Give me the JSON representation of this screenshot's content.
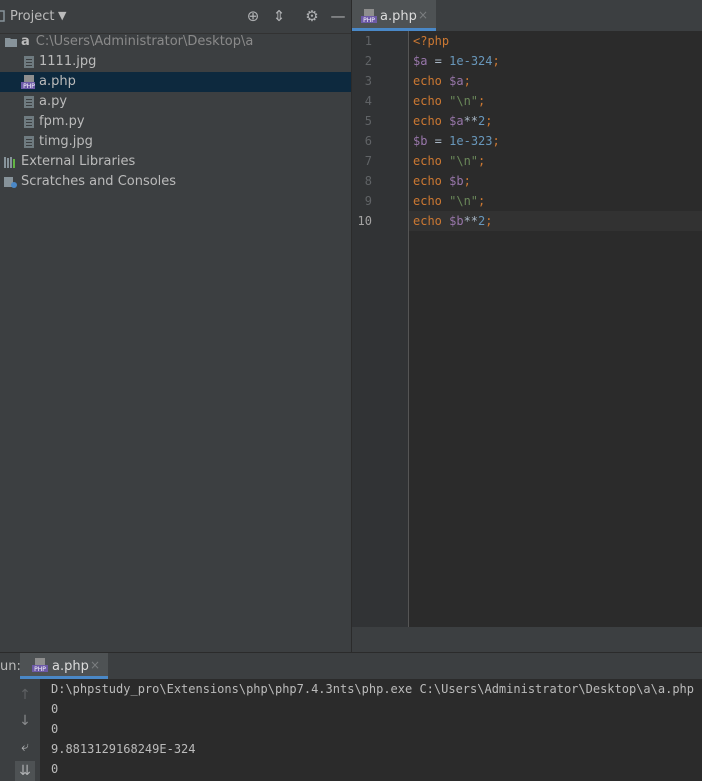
{
  "project": {
    "title": "Project",
    "tree": [
      {
        "label": "a",
        "path": "C:\\Users\\Administrator\\Desktop\\a",
        "icon": "folder-icon"
      },
      {
        "label": "1111.jpg",
        "icon": "image-file-icon"
      },
      {
        "label": "a.php",
        "icon": "php-file-icon",
        "selected": true
      },
      {
        "label": "a.py",
        "icon": "python-file-icon"
      },
      {
        "label": "fpm.py",
        "icon": "python-file-icon"
      },
      {
        "label": "timg.jpg",
        "icon": "image-file-icon"
      },
      {
        "label": "External Libraries",
        "icon": "library-icon"
      },
      {
        "label": "Scratches and Consoles",
        "icon": "scratches-icon"
      }
    ]
  },
  "editor": {
    "tab_label": "a.php",
    "tab_close": "×",
    "line_numbers": [
      "1",
      "2",
      "3",
      "4",
      "5",
      "6",
      "7",
      "8",
      "9",
      "10"
    ],
    "caret_line": "10",
    "code": [
      {
        "t1": "<?php",
        "t2": "",
        "t3": "",
        "t4": "",
        "t5": "",
        "t6": "",
        "t7": ""
      },
      {
        "t1": "$a",
        "t2": " = ",
        "t3": "1e-324",
        "t4": ";",
        "t5": "",
        "t6": "",
        "t7": ""
      },
      {
        "t1": "echo ",
        "t2": "$a",
        "t3": ";",
        "t4": "",
        "t5": "",
        "t6": "",
        "t7": ""
      },
      {
        "t1": "echo ",
        "t2": "\"\\n\"",
        "t3": ";",
        "t4": "",
        "t5": "",
        "t6": "",
        "t7": ""
      },
      {
        "t1": "echo ",
        "t2": "$a",
        "t3": "**",
        "t4": "2",
        "t5": ";",
        "t6": "",
        "t7": ""
      },
      {
        "t1": "$b",
        "t2": " = ",
        "t3": "1e-323",
        "t4": ";",
        "t5": "",
        "t6": "",
        "t7": ""
      },
      {
        "t1": "echo ",
        "t2": "\"\\n\"",
        "t3": ";",
        "t4": "",
        "t5": "",
        "t6": "",
        "t7": ""
      },
      {
        "t1": "echo ",
        "t2": "$b",
        "t3": ";",
        "t4": "",
        "t5": "",
        "t6": "",
        "t7": ""
      },
      {
        "t1": "echo ",
        "t2": "\"\\n\"",
        "t3": ";",
        "t4": "",
        "t5": "",
        "t6": "",
        "t7": ""
      },
      {
        "t1": "echo ",
        "t2": "$b",
        "t3": "**",
        "t4": "2",
        "t5": ";",
        "t6": "",
        "t7": ""
      }
    ]
  },
  "run": {
    "label": "un:",
    "tab_label": "a.php",
    "tab_close": "×",
    "output": [
      "D:\\phpstudy_pro\\Extensions\\php\\php7.4.3nts\\php.exe C:\\Users\\Administrator\\Desktop\\a\\a.php",
      "0",
      "0",
      "9.8813129168249E-324",
      "0"
    ]
  },
  "colors": {
    "background": "#3c3f41",
    "editor_bg": "#2b2b2b",
    "keyword": "#cc7832",
    "variable": "#9876aa",
    "number": "#6897bb",
    "string": "#6a8759",
    "selection": "#0d293e",
    "accent": "#4a88c7"
  }
}
